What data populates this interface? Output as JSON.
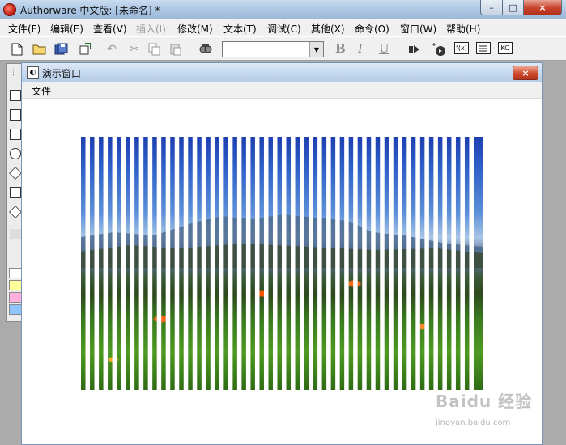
{
  "app": {
    "title": "Authorware 中文版: [未命名] *"
  },
  "window_controls": {
    "minimize": "–",
    "maximize": "□",
    "close": "×"
  },
  "menu": [
    {
      "label": "文件(F)",
      "enabled": true
    },
    {
      "label": "编辑(E)",
      "enabled": true
    },
    {
      "label": "查看(V)",
      "enabled": true
    },
    {
      "label": "插入(I)",
      "enabled": false
    },
    {
      "label": "修改(M)",
      "enabled": true
    },
    {
      "label": "文本(T)",
      "enabled": true
    },
    {
      "label": "调试(C)",
      "enabled": true
    },
    {
      "label": "其他(X)",
      "enabled": true
    },
    {
      "label": "命令(O)",
      "enabled": true
    },
    {
      "label": "窗口(W)",
      "enabled": true
    },
    {
      "label": "帮助(H)",
      "enabled": true
    }
  ],
  "toolbar": {
    "font_value": "",
    "bold_label": "B",
    "italic_label": "I",
    "underline_label": "U",
    "func_label": "f(x)",
    "ko_label": "KO"
  },
  "presentation_window": {
    "title": "演示窗口",
    "menu_file": "文件",
    "close": "×"
  },
  "stage": {
    "stripe_count": 45,
    "stripe_color": "#ffffff"
  },
  "watermark": {
    "text": "Baidu 经验",
    "sub": "jingyan.baidu.com"
  }
}
